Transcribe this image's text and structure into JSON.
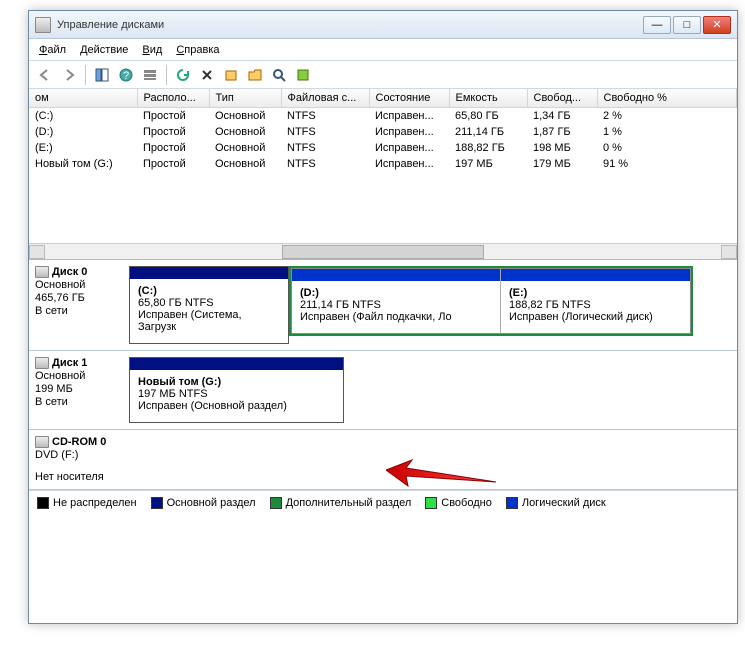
{
  "window": {
    "title": "Управление дисками"
  },
  "menu": {
    "file": "Файл",
    "action": "Действие",
    "view": "Вид",
    "help": "Справка"
  },
  "columns": {
    "c0": "ом",
    "c1": "Располо...",
    "c2": "Тип",
    "c3": "Файловая с...",
    "c4": "Состояние",
    "c5": "Емкость",
    "c6": "Свобод...",
    "c7": "Свободно %"
  },
  "rows": [
    {
      "vol": "(C:)",
      "layout": "Простой",
      "type": "Основной",
      "fs": "NTFS",
      "status": "Исправен...",
      "cap": "65,80 ГБ",
      "free": "1,34 ГБ",
      "pct": "2 %"
    },
    {
      "vol": "(D:)",
      "layout": "Простой",
      "type": "Основной",
      "fs": "NTFS",
      "status": "Исправен...",
      "cap": "211,14 ГБ",
      "free": "1,87 ГБ",
      "pct": "1 %"
    },
    {
      "vol": "(E:)",
      "layout": "Простой",
      "type": "Основной",
      "fs": "NTFS",
      "status": "Исправен...",
      "cap": "188,82 ГБ",
      "free": "198 МБ",
      "pct": "0 %"
    },
    {
      "vol": "Новый том (G:)",
      "layout": "Простой",
      "type": "Основной",
      "fs": "NTFS",
      "status": "Исправен...",
      "cap": "197 МБ",
      "free": "179 МБ",
      "pct": "91 %"
    }
  ],
  "disk0": {
    "name": "Диск 0",
    "type": "Основной",
    "size": "465,76 ГБ",
    "status": "В сети",
    "c": {
      "name": "(C:)",
      "size": "65,80 ГБ NTFS",
      "status": "Исправен (Система, Загрузк"
    },
    "d": {
      "name": "(D:)",
      "size": "211,14 ГБ NTFS",
      "status": "Исправен (Файл подкачки, Ло"
    },
    "e": {
      "name": "(E:)",
      "size": "188,82 ГБ NTFS",
      "status": "Исправен (Логический диск)"
    }
  },
  "disk1": {
    "name": "Диск 1",
    "type": "Основной",
    "size": "199 МБ",
    "status": "В сети",
    "g": {
      "name": "Новый том  (G:)",
      "size": "197 МБ NTFS",
      "status": "Исправен (Основной раздел)"
    }
  },
  "cdrom": {
    "name": "CD-ROM 0",
    "type": "DVD (F:)",
    "status": "Нет носителя"
  },
  "legend": {
    "unalloc": "Не распределен",
    "primary": "Основной раздел",
    "extended": "Дополнительный раздел",
    "free": "Свободно",
    "logical": "Логический диск"
  }
}
